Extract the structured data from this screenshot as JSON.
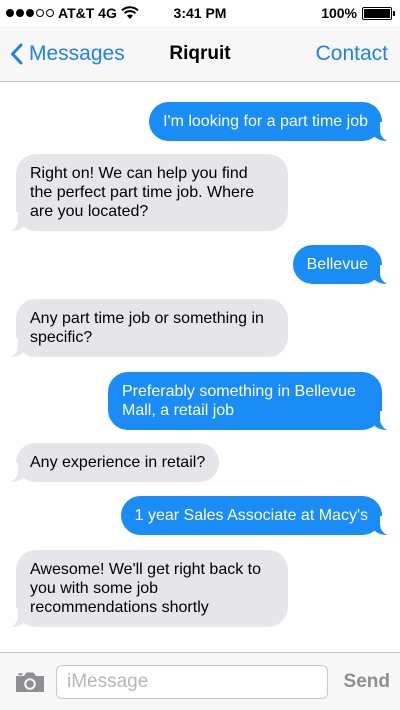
{
  "status_bar": {
    "carrier": "AT&T 4G",
    "time": "3:41 PM",
    "battery": "100%",
    "battery_level": 1.0,
    "signal_bars": 3,
    "signal_total": 5
  },
  "nav": {
    "back_label": "Messages",
    "title": "Riqruit",
    "contact_label": "Contact"
  },
  "messages": [
    {
      "direction": "out",
      "text": "I'm looking for a part time job"
    },
    {
      "direction": "in",
      "text": "Right on! We can help you find the perfect part time job. Where are you located?"
    },
    {
      "direction": "out",
      "text": "Bellevue"
    },
    {
      "direction": "in",
      "text": "Any part time job or something in specific?"
    },
    {
      "direction": "out",
      "text": "Preferably something in Bellevue Mall, a retail job"
    },
    {
      "direction": "in",
      "text": "Any experience in retail?"
    },
    {
      "direction": "out",
      "text": "1 year Sales Associate at Macy's"
    },
    {
      "direction": "in",
      "text": "Awesome! We'll get right back to you with some job recommendations shortly"
    }
  ],
  "input": {
    "placeholder": "iMessage",
    "value": "",
    "send_label": "Send"
  },
  "colors": {
    "accent": "#1b82f0",
    "outgoing_bubble": "#1a8cf6",
    "incoming_bubble": "#e5e5ea"
  }
}
